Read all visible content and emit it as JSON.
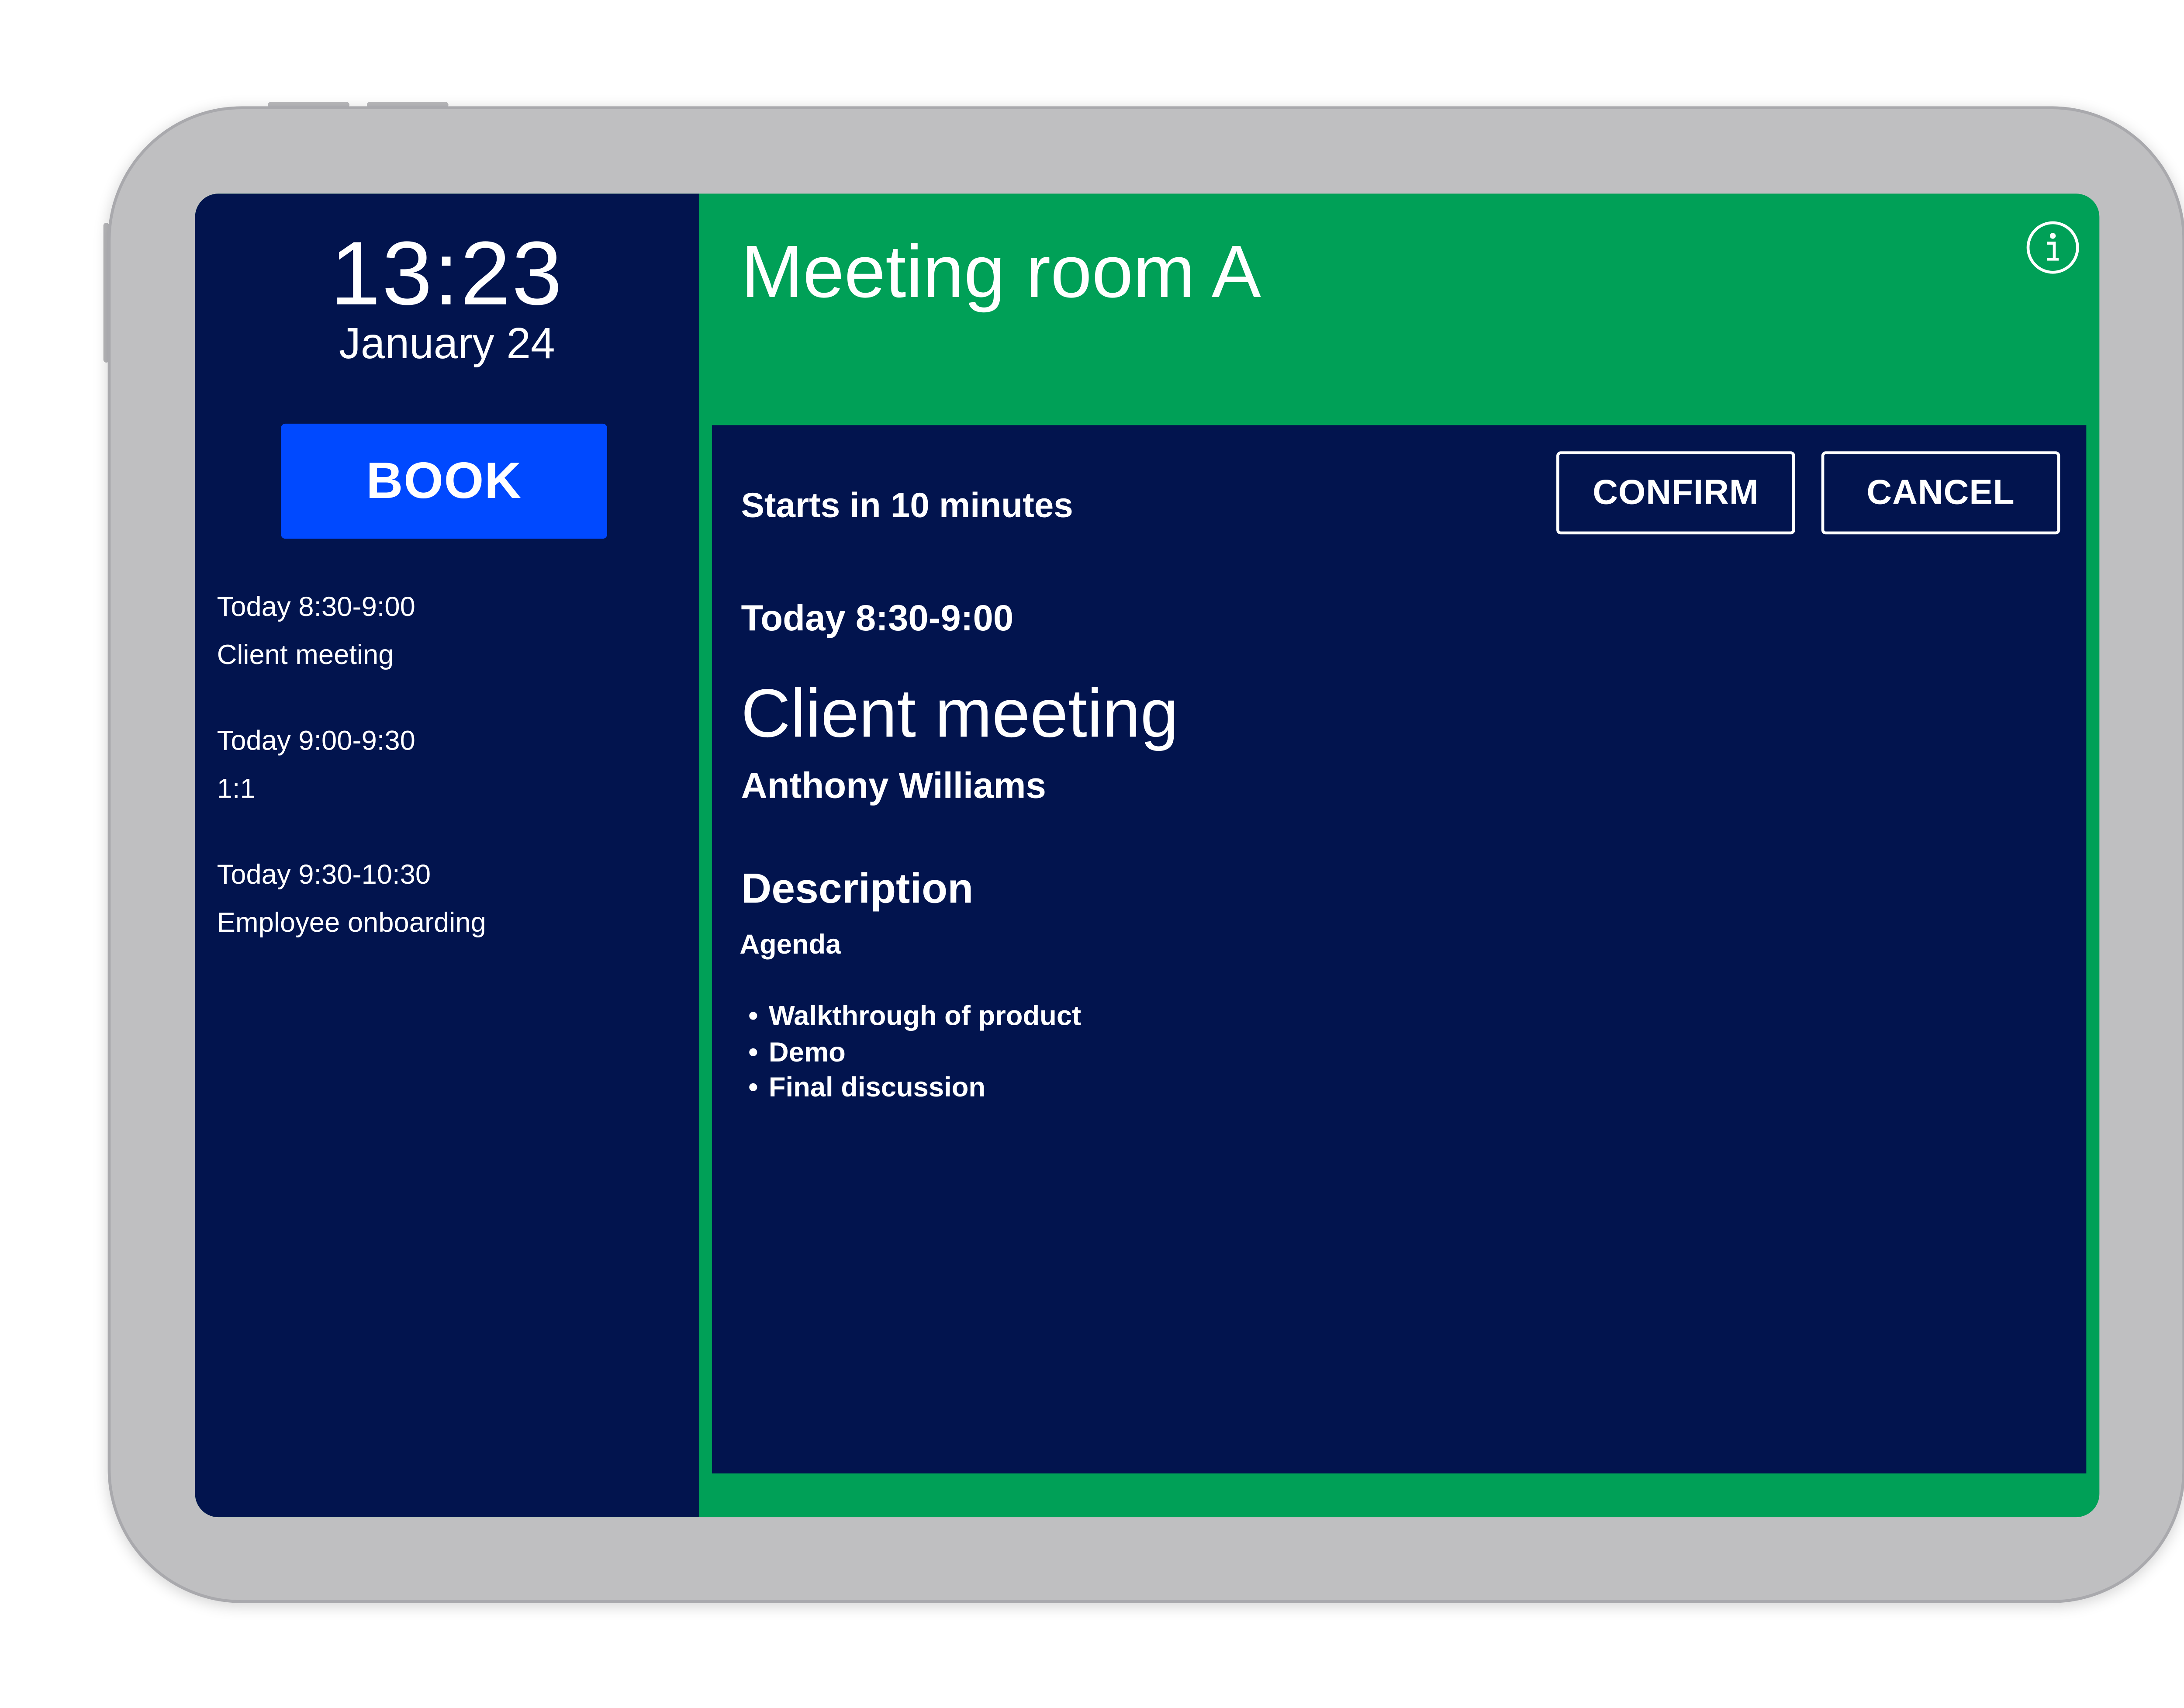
{
  "colors": {
    "sidebar_bg": "#02144e",
    "status_bg": "#00a057",
    "book_button": "#0049ff",
    "panel_bg": "#02144e",
    "device_frame": "#bfbfc1",
    "text": "#ffffff"
  },
  "sidebar": {
    "time": "13:23",
    "date": "January 24",
    "book_label": "BOOK",
    "schedule": [
      {
        "time": "Today 8:30-9:00",
        "title": "Client meeting"
      },
      {
        "time": "Today 9:00-9:30",
        "title": "1:1"
      },
      {
        "time": "Today 9:30-10:30",
        "title": "Employee onboarding"
      }
    ]
  },
  "header": {
    "room_name": "Meeting room A",
    "info_icon": "info-icon"
  },
  "meeting": {
    "status": "Starts in 10 minutes",
    "confirm_label": "CONFIRM",
    "cancel_label": "CANCEL",
    "time": "Today 8:30-9:00",
    "title": "Client meeting",
    "organizer": "Anthony Williams",
    "description_heading": "Description",
    "agenda_label": "Agenda",
    "agenda_items": [
      "Walkthrough of product",
      "Demo",
      "Final discussion"
    ]
  }
}
